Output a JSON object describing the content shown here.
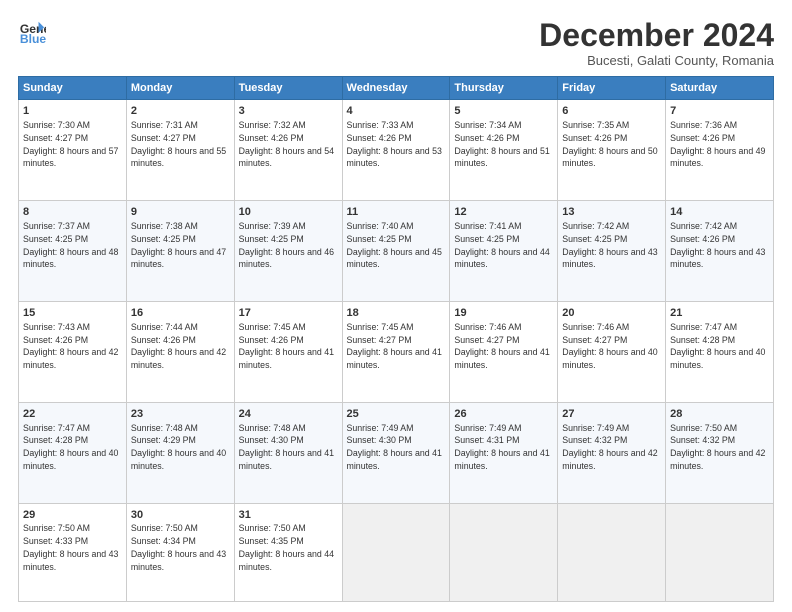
{
  "header": {
    "logo_line1": "General",
    "logo_line2": "Blue",
    "month": "December 2024",
    "location": "Bucesti, Galati County, Romania"
  },
  "days_of_week": [
    "Sunday",
    "Monday",
    "Tuesday",
    "Wednesday",
    "Thursday",
    "Friday",
    "Saturday"
  ],
  "weeks": [
    [
      {
        "day": 1,
        "sunrise": "7:30 AM",
        "sunset": "4:27 PM",
        "daylight": "8 hours and 57 minutes."
      },
      {
        "day": 2,
        "sunrise": "7:31 AM",
        "sunset": "4:27 PM",
        "daylight": "8 hours and 55 minutes."
      },
      {
        "day": 3,
        "sunrise": "7:32 AM",
        "sunset": "4:26 PM",
        "daylight": "8 hours and 54 minutes."
      },
      {
        "day": 4,
        "sunrise": "7:33 AM",
        "sunset": "4:26 PM",
        "daylight": "8 hours and 53 minutes."
      },
      {
        "day": 5,
        "sunrise": "7:34 AM",
        "sunset": "4:26 PM",
        "daylight": "8 hours and 51 minutes."
      },
      {
        "day": 6,
        "sunrise": "7:35 AM",
        "sunset": "4:26 PM",
        "daylight": "8 hours and 50 minutes."
      },
      {
        "day": 7,
        "sunrise": "7:36 AM",
        "sunset": "4:26 PM",
        "daylight": "8 hours and 49 minutes."
      }
    ],
    [
      {
        "day": 8,
        "sunrise": "7:37 AM",
        "sunset": "4:25 PM",
        "daylight": "8 hours and 48 minutes."
      },
      {
        "day": 9,
        "sunrise": "7:38 AM",
        "sunset": "4:25 PM",
        "daylight": "8 hours and 47 minutes."
      },
      {
        "day": 10,
        "sunrise": "7:39 AM",
        "sunset": "4:25 PM",
        "daylight": "8 hours and 46 minutes."
      },
      {
        "day": 11,
        "sunrise": "7:40 AM",
        "sunset": "4:25 PM",
        "daylight": "8 hours and 45 minutes."
      },
      {
        "day": 12,
        "sunrise": "7:41 AM",
        "sunset": "4:25 PM",
        "daylight": "8 hours and 44 minutes."
      },
      {
        "day": 13,
        "sunrise": "7:42 AM",
        "sunset": "4:25 PM",
        "daylight": "8 hours and 43 minutes."
      },
      {
        "day": 14,
        "sunrise": "7:42 AM",
        "sunset": "4:26 PM",
        "daylight": "8 hours and 43 minutes."
      }
    ],
    [
      {
        "day": 15,
        "sunrise": "7:43 AM",
        "sunset": "4:26 PM",
        "daylight": "8 hours and 42 minutes."
      },
      {
        "day": 16,
        "sunrise": "7:44 AM",
        "sunset": "4:26 PM",
        "daylight": "8 hours and 42 minutes."
      },
      {
        "day": 17,
        "sunrise": "7:45 AM",
        "sunset": "4:26 PM",
        "daylight": "8 hours and 41 minutes."
      },
      {
        "day": 18,
        "sunrise": "7:45 AM",
        "sunset": "4:27 PM",
        "daylight": "8 hours and 41 minutes."
      },
      {
        "day": 19,
        "sunrise": "7:46 AM",
        "sunset": "4:27 PM",
        "daylight": "8 hours and 41 minutes."
      },
      {
        "day": 20,
        "sunrise": "7:46 AM",
        "sunset": "4:27 PM",
        "daylight": "8 hours and 40 minutes."
      },
      {
        "day": 21,
        "sunrise": "7:47 AM",
        "sunset": "4:28 PM",
        "daylight": "8 hours and 40 minutes."
      }
    ],
    [
      {
        "day": 22,
        "sunrise": "7:47 AM",
        "sunset": "4:28 PM",
        "daylight": "8 hours and 40 minutes."
      },
      {
        "day": 23,
        "sunrise": "7:48 AM",
        "sunset": "4:29 PM",
        "daylight": "8 hours and 40 minutes."
      },
      {
        "day": 24,
        "sunrise": "7:48 AM",
        "sunset": "4:30 PM",
        "daylight": "8 hours and 41 minutes."
      },
      {
        "day": 25,
        "sunrise": "7:49 AM",
        "sunset": "4:30 PM",
        "daylight": "8 hours and 41 minutes."
      },
      {
        "day": 26,
        "sunrise": "7:49 AM",
        "sunset": "4:31 PM",
        "daylight": "8 hours and 41 minutes."
      },
      {
        "day": 27,
        "sunrise": "7:49 AM",
        "sunset": "4:32 PM",
        "daylight": "8 hours and 42 minutes."
      },
      {
        "day": 28,
        "sunrise": "7:50 AM",
        "sunset": "4:32 PM",
        "daylight": "8 hours and 42 minutes."
      }
    ],
    [
      {
        "day": 29,
        "sunrise": "7:50 AM",
        "sunset": "4:33 PM",
        "daylight": "8 hours and 43 minutes."
      },
      {
        "day": 30,
        "sunrise": "7:50 AM",
        "sunset": "4:34 PM",
        "daylight": "8 hours and 43 minutes."
      },
      {
        "day": 31,
        "sunrise": "7:50 AM",
        "sunset": "4:35 PM",
        "daylight": "8 hours and 44 minutes."
      },
      null,
      null,
      null,
      null
    ]
  ]
}
